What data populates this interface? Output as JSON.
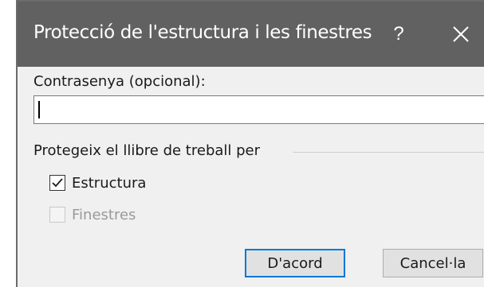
{
  "dialog": {
    "title": "Protecció de l'estructura i les finestres",
    "help_glyph": "?",
    "close_icon": "close-icon"
  },
  "password": {
    "label": "Contrasenya (opcional):",
    "value": "",
    "placeholder": ""
  },
  "protect_group": {
    "label": "Protegeix el llibre de treball per",
    "options": [
      {
        "label": "Estructura",
        "checked": true,
        "enabled": true
      },
      {
        "label": "Finestres",
        "checked": false,
        "enabled": false
      }
    ]
  },
  "buttons": {
    "ok": "D'acord",
    "cancel": "Cancel·la"
  },
  "colors": {
    "titlebar": "#616161",
    "dialog_bg": "#f0f0f0",
    "default_button_border": "#0078d7"
  }
}
